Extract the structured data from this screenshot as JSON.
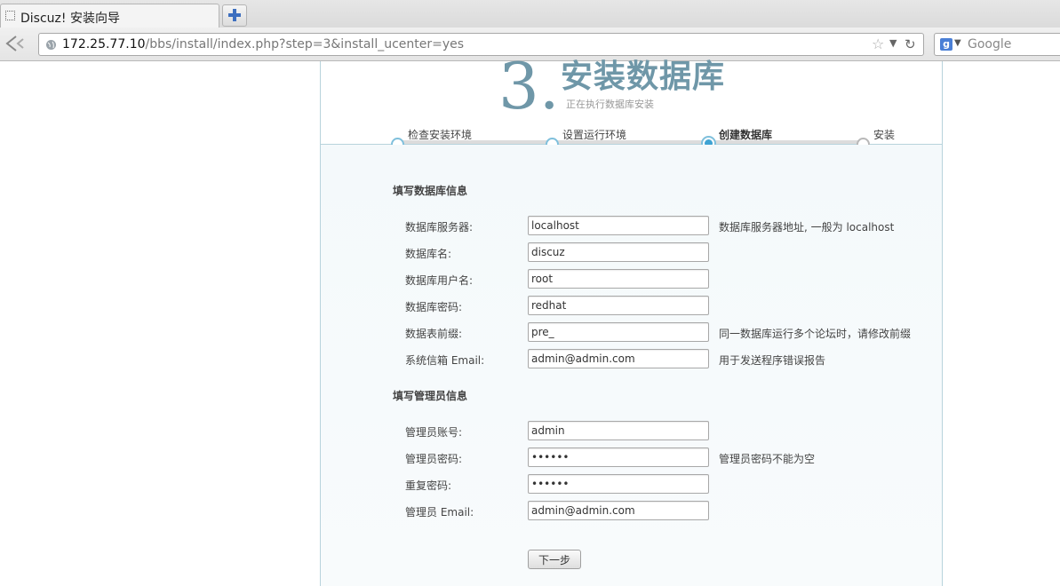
{
  "browser": {
    "tab_title": "Discuz! 安装向导",
    "url_host": "172.25.77.10",
    "url_path": "/bbs/install/index.php?step=3&install_ucenter=yes",
    "search_placeholder": "Google",
    "icons": [
      "page-icon",
      "new-tab-icon",
      "back-icon",
      "globe-icon",
      "star-icon",
      "dropdown-icon",
      "reload-icon",
      "google-icon"
    ]
  },
  "header": {
    "step_number": "3.",
    "title": "安装数据库",
    "subtitle": "正在执行数据库安装"
  },
  "steps": [
    {
      "label": "检查安装环境",
      "state": "done"
    },
    {
      "label": "设置运行环境",
      "state": "done"
    },
    {
      "label": "创建数据库",
      "state": "current"
    },
    {
      "label": "安装",
      "state": "todo"
    }
  ],
  "db_section": {
    "title": "填写数据库信息",
    "fields": [
      {
        "label": "数据库服务器:",
        "value": "localhost",
        "hint": "数据库服务器地址, 一般为 localhost"
      },
      {
        "label": "数据库名:",
        "value": "discuz",
        "hint": ""
      },
      {
        "label": "数据库用户名:",
        "value": "root",
        "hint": ""
      },
      {
        "label": "数据库密码:",
        "value": "redhat",
        "hint": ""
      },
      {
        "label": "数据表前缀:",
        "value": "pre_",
        "hint": "同一数据库运行多个论坛时，请修改前缀"
      },
      {
        "label": "系统信箱 Email:",
        "value": "admin@admin.com",
        "hint": "用于发送程序错误报告"
      }
    ]
  },
  "admin_section": {
    "title": "填写管理员信息",
    "fields": [
      {
        "label": "管理员账号:",
        "value": "admin",
        "hint": ""
      },
      {
        "label": "管理员密码:",
        "value": "••••••",
        "hint": "管理员密码不能为空"
      },
      {
        "label": "重复密码:",
        "value": "••••••",
        "hint": ""
      },
      {
        "label": "管理员 Email:",
        "value": "admin@admin.com",
        "hint": ""
      }
    ]
  },
  "next_button": "下一步",
  "colors": {
    "accent": "#6f97a8",
    "step_active": "#3fa3d3",
    "border": "#b8d3dc"
  }
}
